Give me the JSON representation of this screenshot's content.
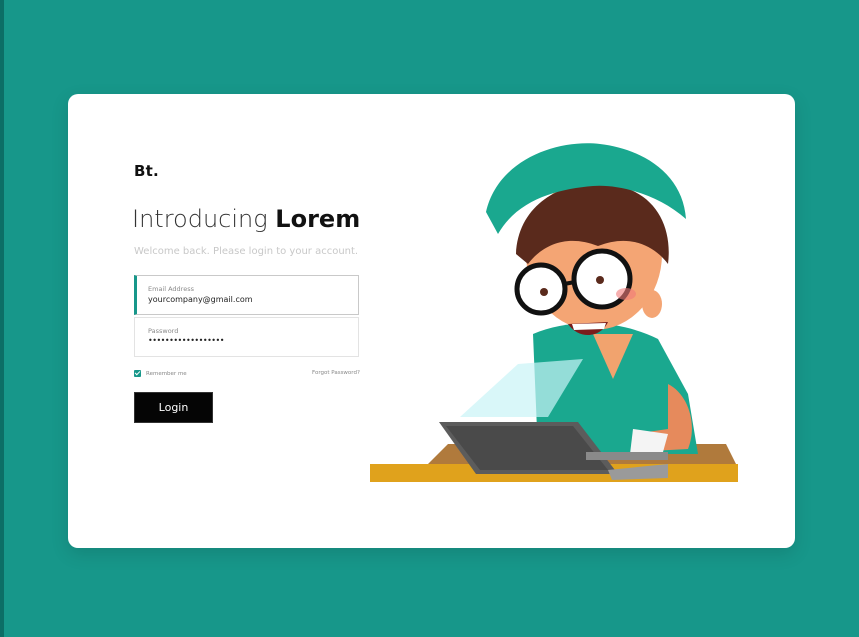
{
  "brand": {
    "logo": "Bt."
  },
  "hero": {
    "title_light": "Introducing",
    "title_bold": "Lorem",
    "subtitle": "Welcome back. Please login to your account."
  },
  "form": {
    "email": {
      "label": "Email Address",
      "value": "yourcompany@gmail.com"
    },
    "password": {
      "label": "Password",
      "value": "••••••••••••••••••"
    },
    "remember_label": "Remember me",
    "remember_checked": true,
    "forgot_label": "Forgot Password?",
    "login_label": "Login"
  },
  "colors": {
    "background": "#17978a",
    "accent": "#17978a",
    "button": "#050505"
  }
}
